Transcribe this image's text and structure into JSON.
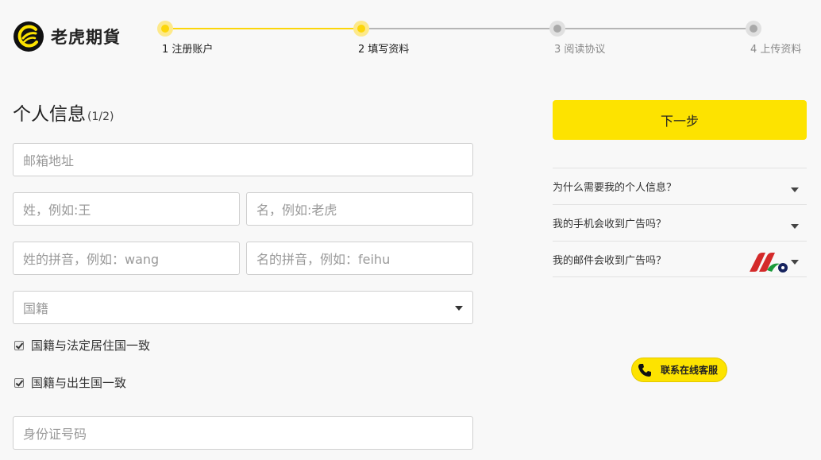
{
  "brand": {
    "name": "老虎期貨",
    "accent": "#fde300"
  },
  "steps": [
    {
      "num": "1",
      "label": "注册账户",
      "state": "active"
    },
    {
      "num": "2",
      "label": "填写资料",
      "state": "active"
    },
    {
      "num": "3",
      "label": "阅读协议",
      "state": "inactive"
    },
    {
      "num": "4",
      "label": "上传资料",
      "state": "inactive"
    }
  ],
  "form": {
    "title": "个人信息",
    "progress": "(1/2)",
    "email_placeholder": "邮箱地址",
    "surname_placeholder": "姓，例如:王",
    "given_name_placeholder": "名，例如:老虎",
    "surname_pinyin_placeholder": "姓的拼音，例如：wang",
    "given_name_pinyin_placeholder": "名的拼音，例如：feihu",
    "nationality_placeholder": "国籍",
    "check_residence": "国籍与法定居住国一致",
    "check_birth": "国籍与出生国一致",
    "id_placeholder": "身份证号码"
  },
  "sidebar": {
    "next_label": "下一步",
    "faq": [
      "为什么需要我的个人信息？",
      "我的手机会收到广告吗？",
      "我的邮件会收到广告吗？"
    ],
    "customer_service_label": "联系在线客服"
  },
  "icons": {
    "logo": "tiger-logo-icon",
    "chevron": "chevron-down-icon",
    "phone": "phone-icon",
    "brand_mark": "brand-mark-icon"
  }
}
